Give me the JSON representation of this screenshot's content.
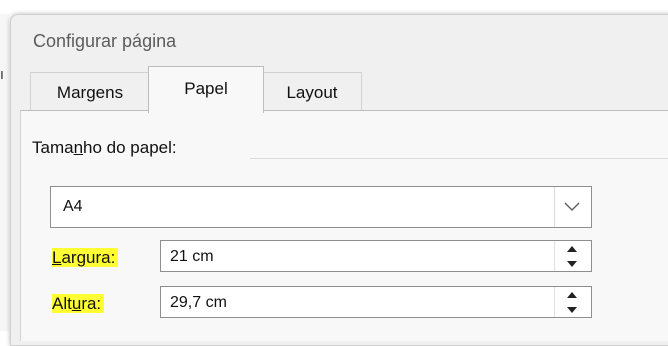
{
  "dialog": {
    "title": "Configurar página",
    "tabs": [
      {
        "label": "Margens",
        "active": false
      },
      {
        "label": "Papel",
        "active": true
      },
      {
        "label": "Layout",
        "active": false
      }
    ]
  },
  "paper_size": {
    "group_label_pre": "Tamanho do papel:",
    "selected": "A4",
    "dropdown_icon": "chevron-down-icon"
  },
  "fields": {
    "width": {
      "label_a": "",
      "label_u": "L",
      "label_b": "argura:",
      "value": "21 cm"
    },
    "height": {
      "label_a": "Alt",
      "label_u": "u",
      "label_b": "ra:",
      "value": "29,7 cm"
    }
  },
  "colors": {
    "highlight": "#ffff33",
    "dialog_bg": "#f0f0f0",
    "panel_bg": "#f8f8f8"
  }
}
